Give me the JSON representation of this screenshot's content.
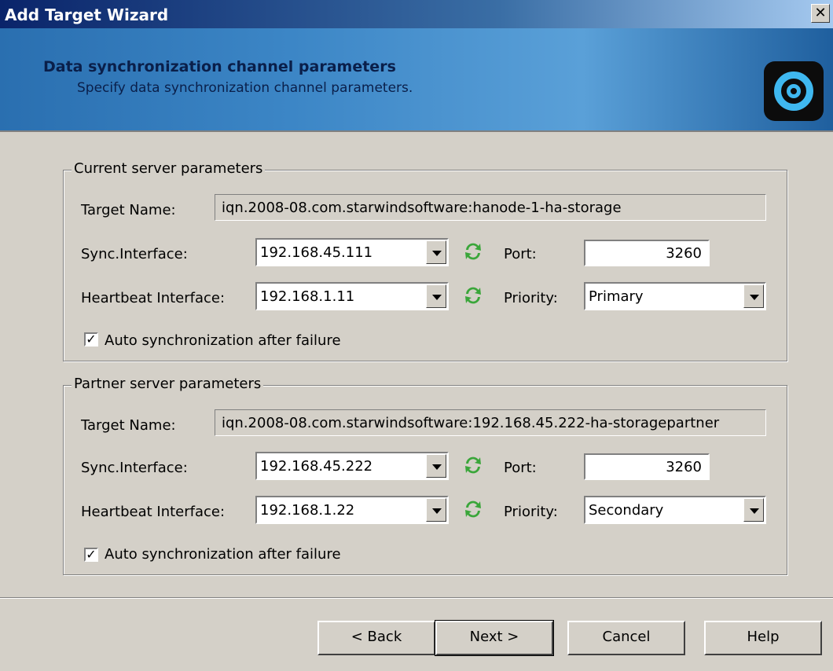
{
  "window": {
    "title": "Add Target Wizard",
    "close_glyph": "✕"
  },
  "header": {
    "title": "Data synchronization channel parameters",
    "subtitle": "Specify data synchronization channel parameters.",
    "logo_icon": "starwind-logo-icon"
  },
  "current": {
    "legend": "Current server parameters",
    "target_label": "Target Name:",
    "target_value": "iqn.2008-08.com.starwindsoftware:hanode-1-ha-storage",
    "sync_label": "Sync.Interface:",
    "sync_value": "192.168.45.111",
    "port_label": "Port:",
    "port_value": "3260",
    "heartbeat_label": "Heartbeat Interface:",
    "heartbeat_value": "192.168.1.11",
    "priority_label": "Priority:",
    "priority_value": "Primary",
    "auto_sync_label": "Auto synchronization after failure",
    "auto_sync_checked": true
  },
  "partner": {
    "legend": "Partner server parameters",
    "target_label": "Target Name:",
    "target_value": "iqn.2008-08.com.starwindsoftware:192.168.45.222-ha-storagepartner",
    "sync_label": "Sync.Interface:",
    "sync_value": "192.168.45.222",
    "port_label": "Port:",
    "port_value": "3260",
    "heartbeat_label": "Heartbeat Interface:",
    "heartbeat_value": "192.168.1.22",
    "priority_label": "Priority:",
    "priority_value": "Secondary",
    "auto_sync_label": "Auto synchronization after failure",
    "auto_sync_checked": true
  },
  "buttons": {
    "back": "< Back",
    "next": "Next >",
    "cancel": "Cancel",
    "help": "Help"
  },
  "colors": {
    "refresh_icon": "#3aa63a",
    "logo_ring": "#3fb8f0"
  }
}
